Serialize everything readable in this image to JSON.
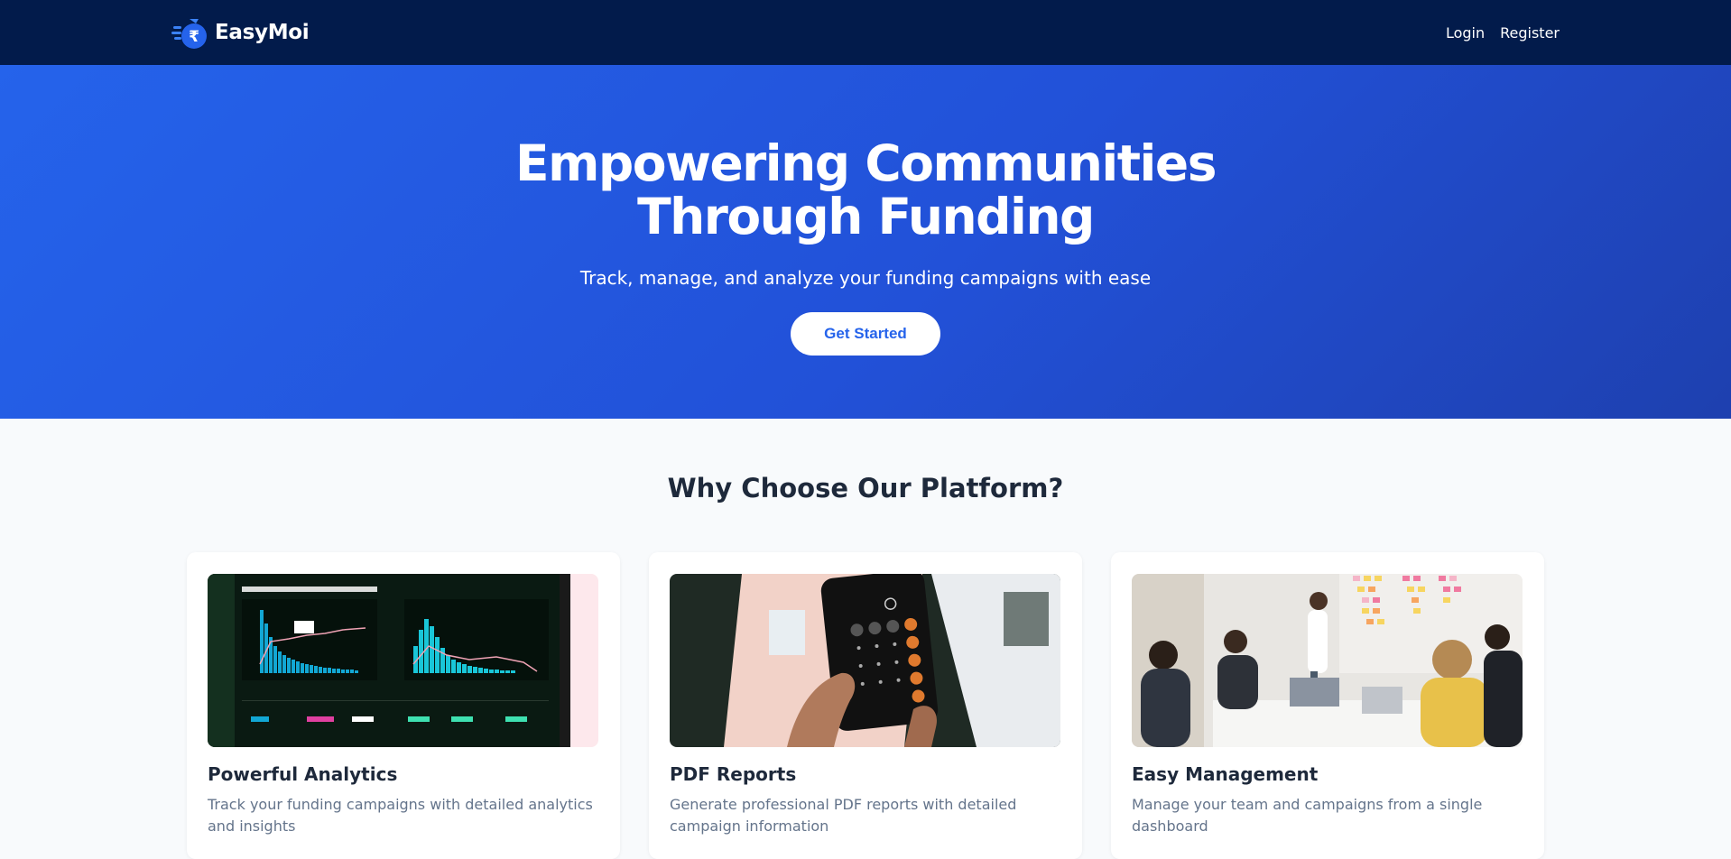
{
  "nav": {
    "brand": "EasyMoi",
    "logo_icon": "rupee-money-bag-icon",
    "links": [
      {
        "label": "Login"
      },
      {
        "label": "Register"
      }
    ]
  },
  "hero": {
    "title_line1": "Empowering Communities",
    "title_line2": "Through Funding",
    "subtitle": "Track, manage, and analyze your funding campaigns with ease",
    "cta_label": "Get Started"
  },
  "features": {
    "heading": "Why Choose Our Platform?",
    "cards": [
      {
        "title": "Powerful Analytics",
        "description": "Track your funding campaigns with detailed analytics and insights",
        "image": "analytics-dashboard-photo"
      },
      {
        "title": "PDF Reports",
        "description": "Generate professional PDF reports with detailed campaign information",
        "image": "calculator-phone-photo"
      },
      {
        "title": "Easy Management",
        "description": "Manage your team and campaigns from a single dashboard",
        "image": "team-meeting-photo"
      }
    ]
  },
  "colors": {
    "navbar_bg": "#021b4b",
    "hero_gradient_start": "#2563eb",
    "hero_gradient_end": "#1e40af",
    "accent": "#2563eb",
    "page_bg": "#f8fafc"
  }
}
